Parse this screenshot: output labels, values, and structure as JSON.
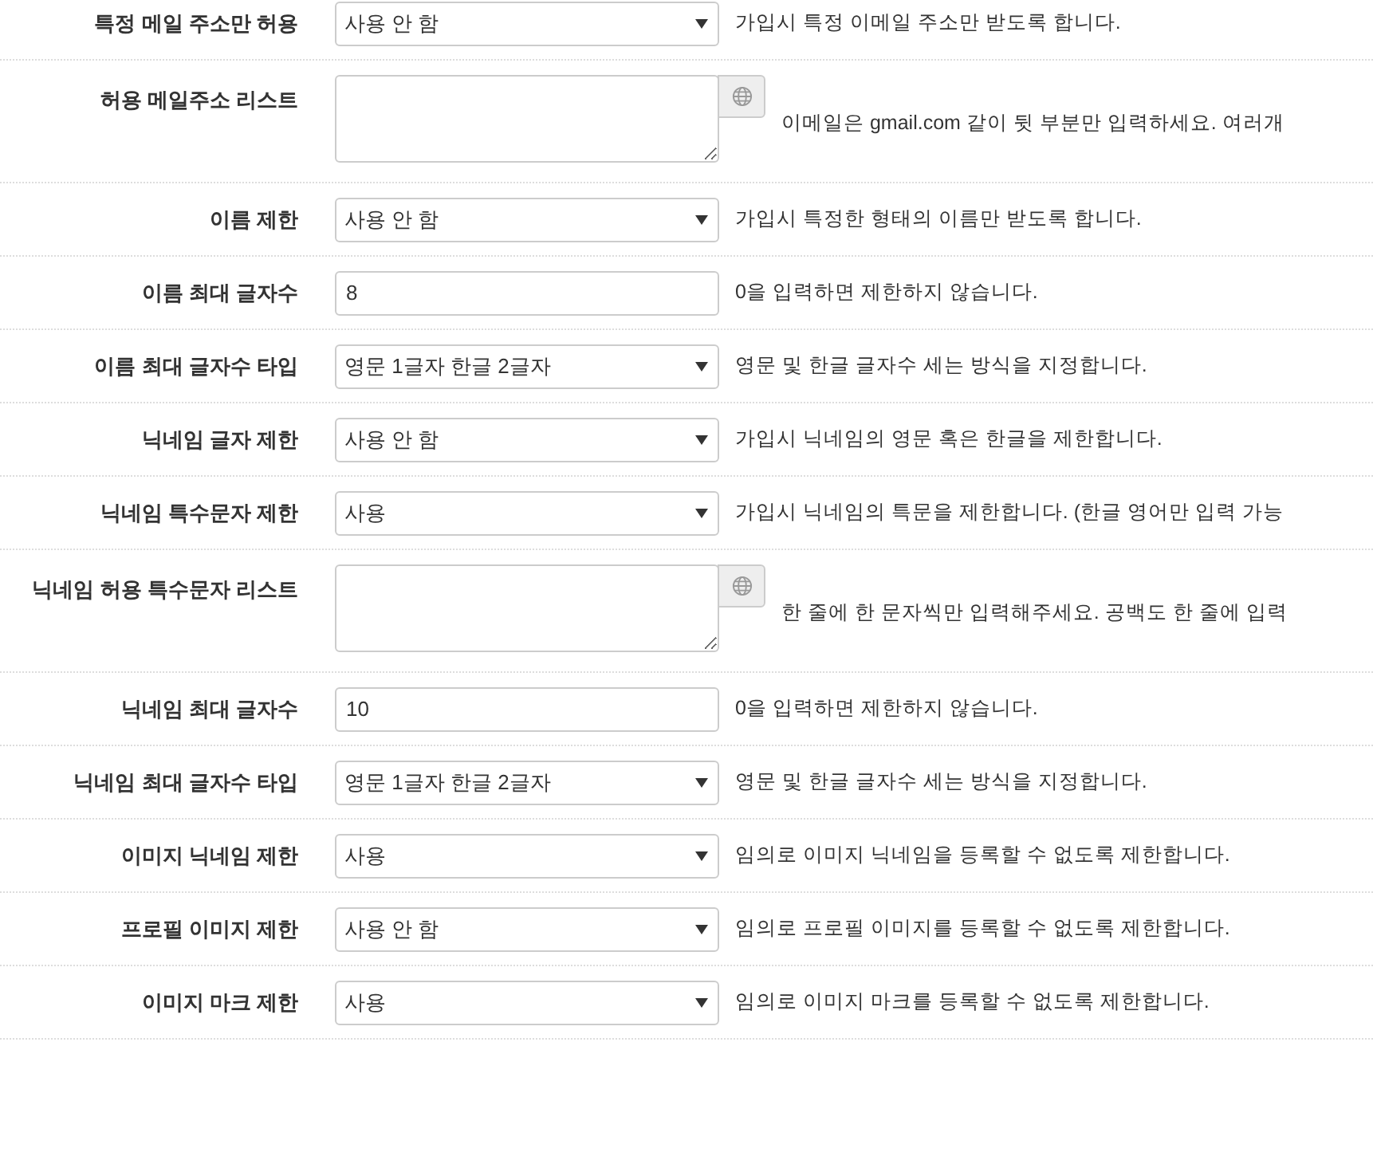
{
  "rows": [
    {
      "label": "특정 메일 주소만 허용",
      "kind": "select",
      "value": "사용 안 함",
      "help": "가입시 특정 이메일 주소만 받도록 합니다."
    },
    {
      "label": "허용 메일주소 리스트",
      "kind": "textarea",
      "value": "",
      "help": "이메일은 gmail.com 같이 뒷 부분만 입력하세요. 여러개"
    },
    {
      "label": "이름 제한",
      "kind": "select",
      "value": "사용 안 함",
      "help": "가입시 특정한 형태의 이름만 받도록 합니다."
    },
    {
      "label": "이름 최대 글자수",
      "kind": "input",
      "value": "8",
      "help": "0을 입력하면 제한하지 않습니다."
    },
    {
      "label": "이름 최대 글자수 타입",
      "kind": "select",
      "value": "영문 1글자 한글 2글자",
      "help": "영문 및 한글 글자수 세는 방식을 지정합니다."
    },
    {
      "label": "닉네임 글자 제한",
      "kind": "select",
      "value": "사용 안 함",
      "help": "가입시 닉네임의 영문 혹은 한글을 제한합니다."
    },
    {
      "label": "닉네임 특수문자 제한",
      "kind": "select",
      "value": "사용",
      "help": "가입시 닉네임의 특문을 제한합니다. (한글 영어만 입력 가능"
    },
    {
      "label": "닉네임 허용 특수문자 리스트",
      "kind": "textarea",
      "value": "",
      "help": "한 줄에 한 문자씩만 입력해주세요. 공백도 한 줄에 입력"
    },
    {
      "label": "닉네임 최대 글자수",
      "kind": "input",
      "value": "10",
      "help": "0을 입력하면 제한하지 않습니다."
    },
    {
      "label": "닉네임 최대 글자수 타입",
      "kind": "select",
      "value": "영문 1글자 한글 2글자",
      "help": "영문 및 한글 글자수 세는 방식을 지정합니다."
    },
    {
      "label": "이미지 닉네임 제한",
      "kind": "select",
      "value": "사용",
      "help": "임의로 이미지 닉네임을 등록할 수 없도록 제한합니다."
    },
    {
      "label": "프로필 이미지 제한",
      "kind": "select",
      "value": "사용 안 함",
      "help": "임의로 프로필 이미지를 등록할 수 없도록 제한합니다."
    },
    {
      "label": "이미지 마크 제한",
      "kind": "select",
      "value": "사용",
      "help": "임의로 이미지 마크를 등록할 수 없도록 제한합니다."
    }
  ]
}
